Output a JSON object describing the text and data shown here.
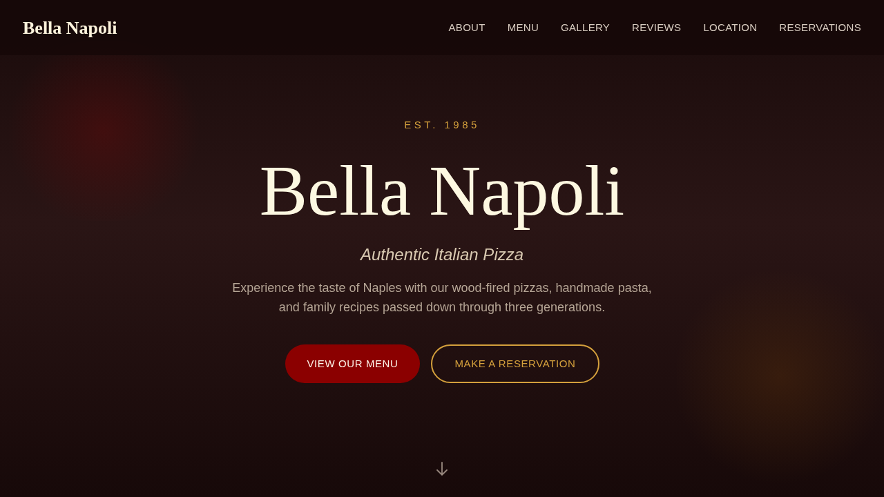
{
  "nav": {
    "logo": "Bella Napoli",
    "links": [
      {
        "label": "ABOUT"
      },
      {
        "label": "MENU"
      },
      {
        "label": "GALLERY"
      },
      {
        "label": "REVIEWS"
      },
      {
        "label": "LOCATION"
      },
      {
        "label": "RESERVATIONS"
      }
    ]
  },
  "hero": {
    "eyebrow": "EST. 1985",
    "title": "Bella Napoli",
    "subtitle": "Authentic Italian Pizza",
    "description": "Experience the taste of Naples with our wood-fired pizzas, handmade pasta, and family recipes passed down through three generations.",
    "buttons": [
      {
        "label": "VIEW OUR MENU",
        "kind": "primary"
      },
      {
        "label": "MAKE A RESERVATION",
        "kind": "outline"
      }
    ]
  }
}
